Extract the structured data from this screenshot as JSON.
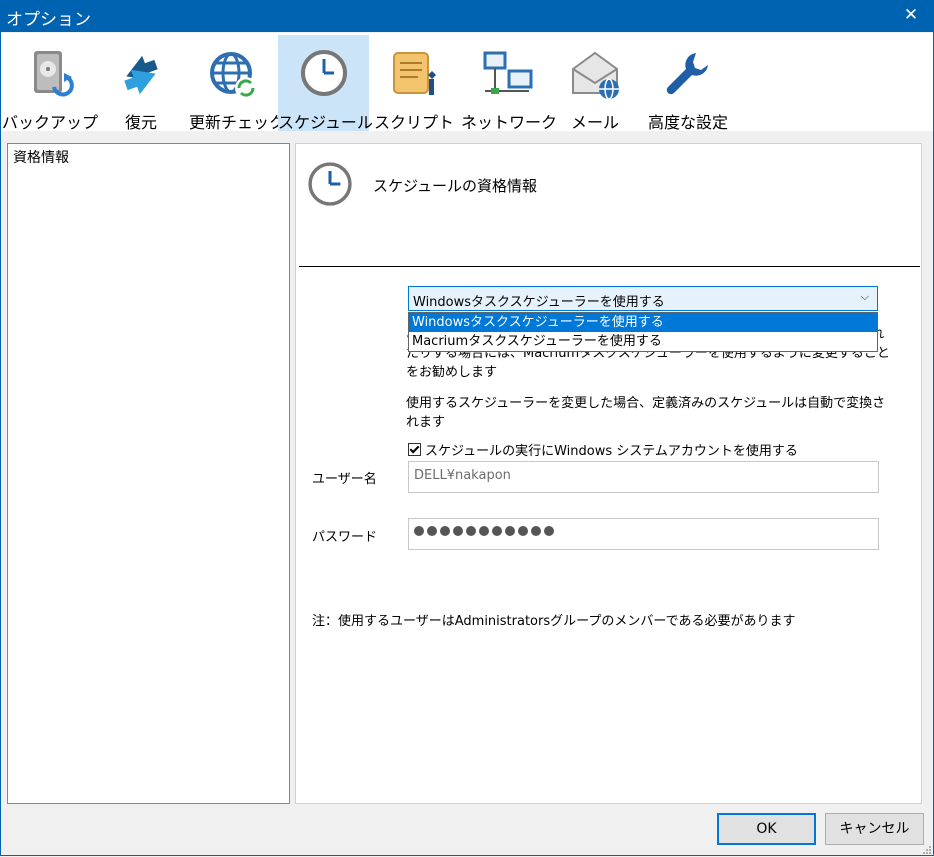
{
  "window": {
    "title": "オプション",
    "close_glyph": "✕"
  },
  "toolbar": {
    "items": [
      {
        "label": "バックアップ",
        "icon": "backup-drive-icon"
      },
      {
        "label": "復元",
        "icon": "restore-arrows-icon"
      },
      {
        "label": "更新チェック",
        "icon": "update-globe-icon"
      },
      {
        "label": "スケジュール",
        "icon": "clock-icon",
        "active": true
      },
      {
        "label": "スクリプト",
        "icon": "script-scroll-icon"
      },
      {
        "label": "ネットワーク",
        "icon": "network-icon"
      },
      {
        "label": "メール",
        "icon": "mail-icon"
      },
      {
        "label": "高度な設定",
        "icon": "wrench-icon"
      }
    ]
  },
  "sidebar": {
    "items": [
      {
        "label": "資格情報"
      }
    ]
  },
  "content": {
    "header_title": "スケジュールの資格情報",
    "scheduler_select": {
      "value": "Windowsタスクスケジューラーを使用する",
      "options": [
        "Windowsタスクスケジューラーを使用する",
        "Macriumタスクスケジューラーを使用する"
      ]
    },
    "info_text": "あります。スケジュールしたバックアップが実行されなかったり、複数回実行されたりする場合には、Macriumタスクスケジューラーを使用するように変更することをお勧めします",
    "change_text": "使用するスケジューラーを変更した場合、定義済みのスケジュールは自動で変換されます",
    "system_account_checkbox": {
      "label": "スケジュールの実行にWindows システムアカウントを使用する",
      "checked": true
    },
    "username_label": "ユーザー名",
    "username_value": "DELL¥nakapon",
    "password_label": "パスワード",
    "password_dots": 11,
    "note": "注：使用するユーザーはAdministratorsグループのメンバーである必要があります"
  },
  "buttons": {
    "ok": "OK",
    "cancel": "キャンセル"
  },
  "colors": {
    "accent": "#0078d7",
    "titlebar": "#0063b1",
    "active_tab": "#cce4f7"
  }
}
